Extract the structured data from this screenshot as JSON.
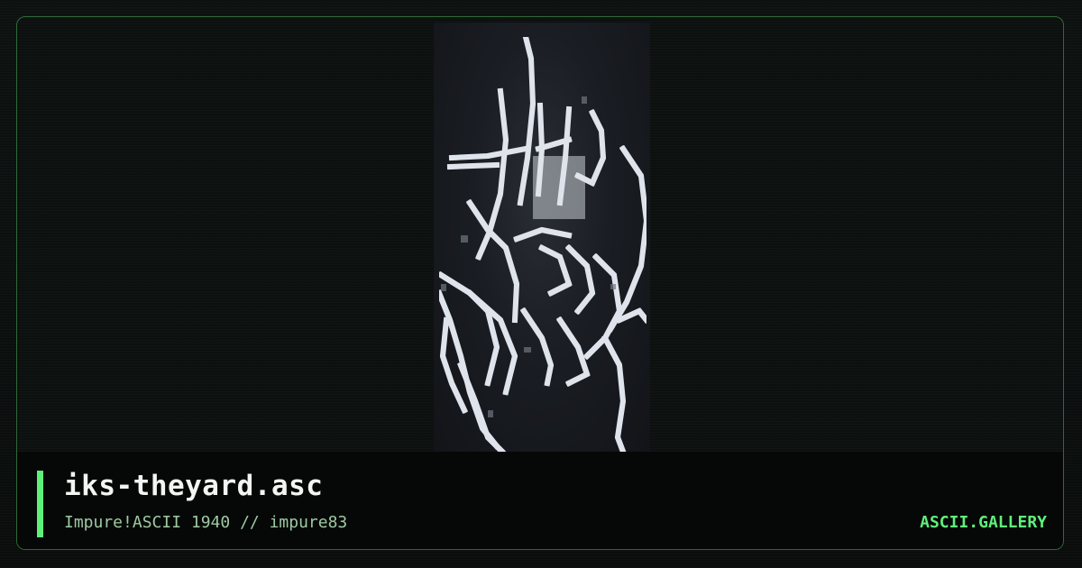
{
  "card": {
    "title": "iks-theyard.asc",
    "subtitle": "Impure!ASCII 1940 // impure83",
    "brand": "ASCII.GALLERY"
  },
  "artwork": {
    "icon": "graffiti-tag-artwork",
    "panel_color": "#1a1d23",
    "stroke_color": "#dfe4ec"
  },
  "colors": {
    "accent": "#5ff07a",
    "frame_border": "#2f6a36",
    "background": "#0b0f0e",
    "info_bar": "#060807",
    "title": "#f2f5f2",
    "subtitle": "#9ec8a2"
  }
}
